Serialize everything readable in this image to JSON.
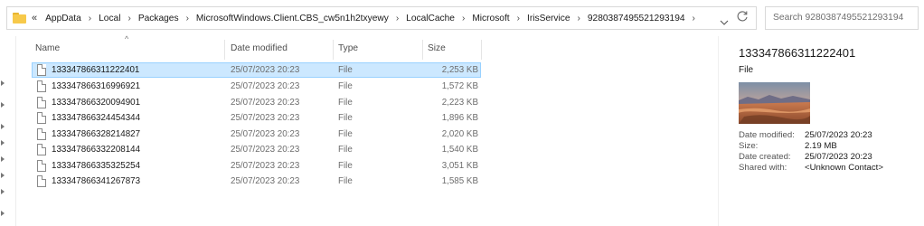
{
  "address_bar": {
    "overflow": "«",
    "crumbs": [
      "AppData",
      "Local",
      "Packages",
      "MicrosoftWindows.Client.CBS_cw5n1h2txyewy",
      "LocalCache",
      "Microsoft",
      "IrisService",
      "9280387495521293194"
    ],
    "separator": "›"
  },
  "search": {
    "placeholder": "Search 9280387495521293194"
  },
  "columns": {
    "name": "Name",
    "date": "Date modified",
    "type": "Type",
    "size": "Size"
  },
  "files": [
    {
      "name": "133347866311222401",
      "date": "25/07/2023 20:23",
      "type": "File",
      "size": "2,253 KB",
      "selected": true
    },
    {
      "name": "133347866316996921",
      "date": "25/07/2023 20:23",
      "type": "File",
      "size": "1,572 KB"
    },
    {
      "name": "133347866320094901",
      "date": "25/07/2023 20:23",
      "type": "File",
      "size": "2,223 KB"
    },
    {
      "name": "133347866324454344",
      "date": "25/07/2023 20:23",
      "type": "File",
      "size": "1,896 KB"
    },
    {
      "name": "133347866328214827",
      "date": "25/07/2023 20:23",
      "type": "File",
      "size": "2,020 KB"
    },
    {
      "name": "133347866332208144",
      "date": "25/07/2023 20:23",
      "type": "File",
      "size": "1,540 KB"
    },
    {
      "name": "133347866335325254",
      "date": "25/07/2023 20:23",
      "type": "File",
      "size": "3,051 KB"
    },
    {
      "name": "133347866341267873",
      "date": "25/07/2023 20:23",
      "type": "File",
      "size": "1,585 KB"
    }
  ],
  "details": {
    "title": "133347866311222401",
    "kind": "File",
    "props": [
      {
        "key": "Date modified:",
        "value": "25/07/2023 20:23"
      },
      {
        "key": "Size:",
        "value": "2.19 MB"
      },
      {
        "key": "Date created:",
        "value": "25/07/2023 20:23"
      },
      {
        "key": "Shared with:",
        "value": "<Unknown Contact>"
      }
    ]
  },
  "colors": {
    "selection_bg": "#cce8ff",
    "selection_border": "#99d1ff",
    "folder": "#f7c94a"
  }
}
